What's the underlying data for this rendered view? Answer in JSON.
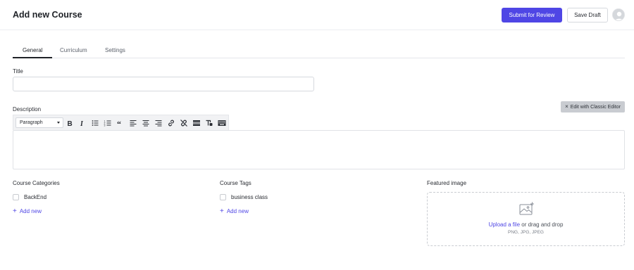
{
  "header": {
    "title": "Add new Course",
    "submit_label": "Submit for Review",
    "draft_label": "Save Draft"
  },
  "tabs": [
    {
      "label": "General",
      "active": true
    },
    {
      "label": "Curriculum",
      "active": false
    },
    {
      "label": "Settings",
      "active": false
    }
  ],
  "title_field": {
    "label": "Title",
    "value": "",
    "placeholder": ""
  },
  "description": {
    "label": "Description",
    "classic_editor_label": "Edit with Classic Editor",
    "format_select": "Paragraph",
    "toolbar_icons": [
      "bold-icon",
      "italic-icon",
      "bulleted-list-icon",
      "numbered-list-icon",
      "quote-icon",
      "align-left-icon",
      "align-center-icon",
      "align-right-icon",
      "link-icon",
      "unlink-icon",
      "horizontal-rule-icon",
      "clear-format-icon",
      "keyboard-icon"
    ]
  },
  "categories": {
    "label": "Course Categories",
    "items": [
      {
        "label": "BackEnd",
        "checked": false
      }
    ],
    "add_label": "Add new"
  },
  "tags": {
    "label": "Course Tags",
    "items": [
      {
        "label": "business class",
        "checked": false
      }
    ],
    "add_label": "Add new"
  },
  "featured_image": {
    "label": "Featured image",
    "upload_link": "Upload a file",
    "upload_rest": " or drag and drop",
    "hint": "PNG, JPG, JPEG"
  },
  "colors": {
    "accent": "#4f46e5",
    "text": "#212327",
    "border": "#d6d9de"
  }
}
